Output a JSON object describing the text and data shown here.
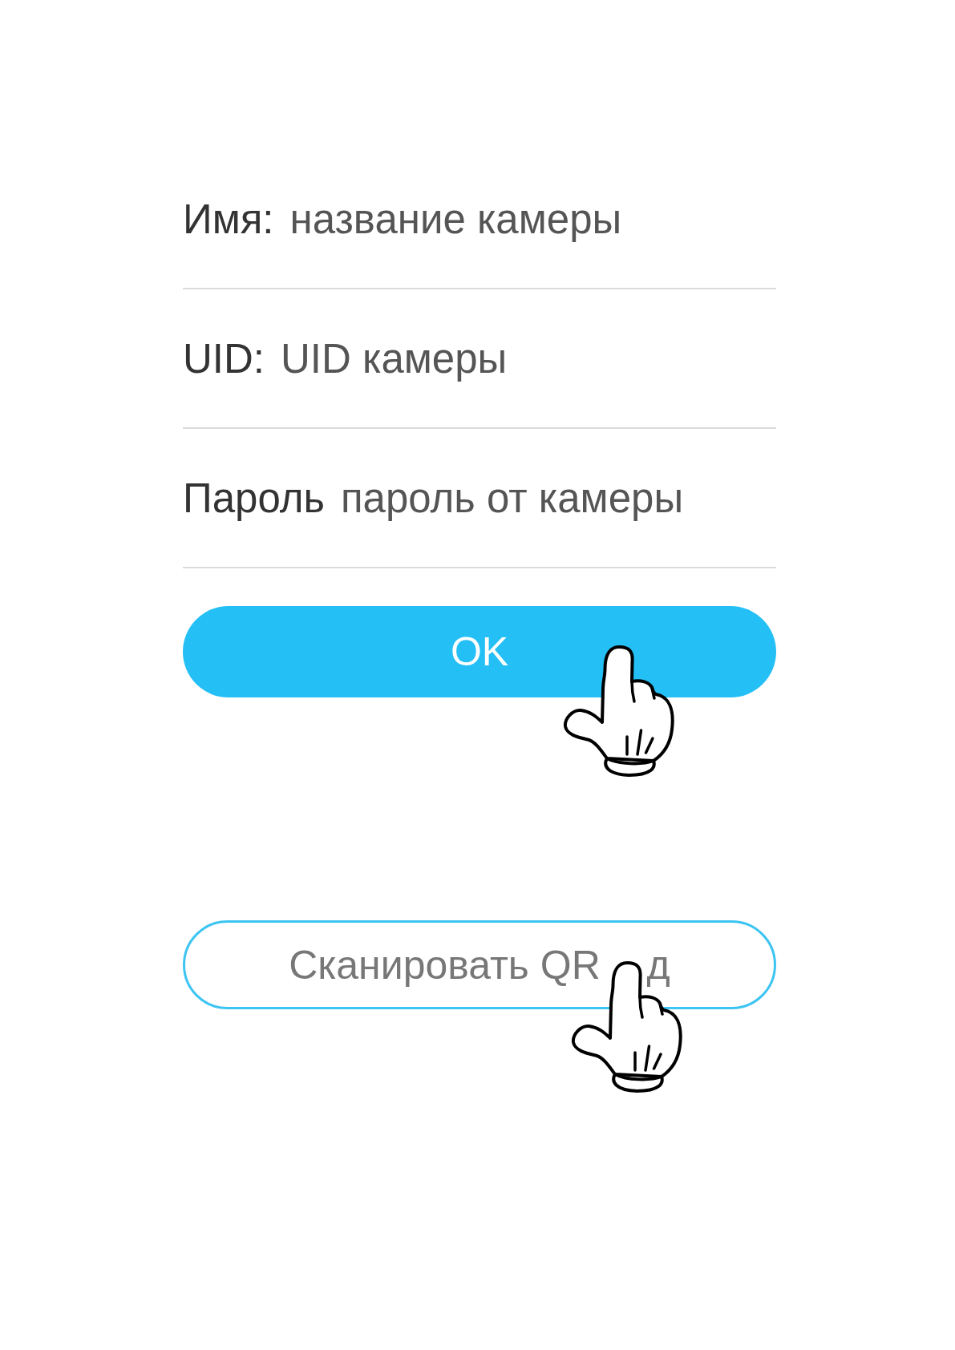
{
  "form": {
    "fields": [
      {
        "label": "Имя:",
        "placeholder": "название камеры"
      },
      {
        "label": "UID:",
        "placeholder": "UID камеры"
      },
      {
        "label": "Пароль",
        "placeholder": "пароль от камеры"
      }
    ]
  },
  "buttons": [
    {
      "kind": "primary",
      "label": "OK"
    },
    {
      "kind": "outline",
      "label": "Сканировать QR",
      "label_end": "д"
    }
  ]
}
